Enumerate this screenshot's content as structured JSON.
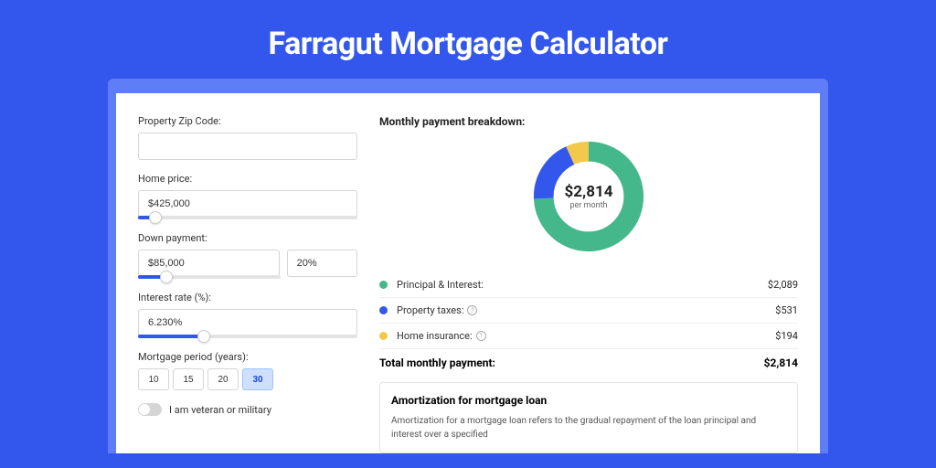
{
  "page_title": "Farragut Mortgage Calculator",
  "form": {
    "zip_label": "Property Zip Code:",
    "zip_value": "",
    "home_price_label": "Home price:",
    "home_price_value": "$425,000",
    "home_price_slider_pct": 8,
    "down_payment_label": "Down payment:",
    "down_payment_value": "$85,000",
    "down_payment_percent": "20%",
    "down_payment_slider_pct": 20,
    "interest_label": "Interest rate (%):",
    "interest_value": "6.230%",
    "interest_slider_pct": 30,
    "period_label": "Mortgage period (years):",
    "period_options": [
      "10",
      "15",
      "20",
      "30"
    ],
    "period_selected": "30",
    "veteran_label": "I am veteran or military"
  },
  "breakdown": {
    "title": "Monthly payment breakdown:",
    "center_amount": "$2,814",
    "center_sub": "per month",
    "items": [
      {
        "label": "Principal & Interest:",
        "value": "$2,089",
        "color": "#44b78b",
        "pct": 0.742,
        "info": false
      },
      {
        "label": "Property taxes:",
        "value": "$531",
        "color": "#3357ec",
        "pct": 0.189,
        "info": true
      },
      {
        "label": "Home insurance:",
        "value": "$194",
        "color": "#f2c94c",
        "pct": 0.069,
        "info": true
      }
    ],
    "total_label": "Total monthly payment:",
    "total_value": "$2,814"
  },
  "amortization": {
    "title": "Amortization for mortgage loan",
    "text": "Amortization for a mortgage loan refers to the gradual repayment of the loan principal and interest over a specified"
  },
  "chart_data": {
    "type": "pie",
    "title": "Monthly payment breakdown",
    "series": [
      {
        "name": "Principal & Interest",
        "value": 2089
      },
      {
        "name": "Property taxes",
        "value": 531
      },
      {
        "name": "Home insurance",
        "value": 194
      }
    ],
    "total": 2814,
    "unit": "USD per month"
  }
}
